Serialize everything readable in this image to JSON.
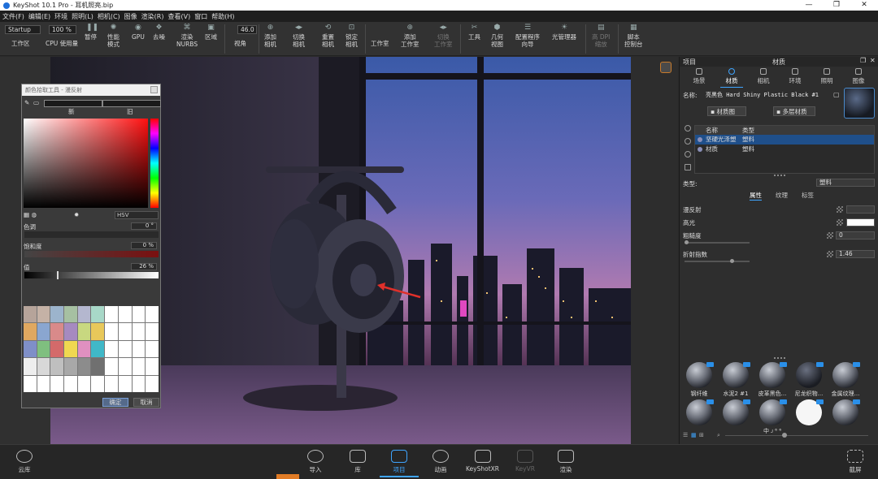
{
  "window": {
    "title": "KeyShot 10.1 Pro  -  耳机照亮.bip",
    "controls": [
      "—",
      "❐",
      "✕"
    ]
  },
  "menu": [
    "文件(F)",
    "编辑(E)",
    "环境",
    "照明(L)",
    "相机(C)",
    "图像",
    "渲染(R)",
    "查看(V)",
    "窗口",
    "帮助(H)"
  ],
  "toolbar": {
    "workspace_select": "Startup",
    "zoom_value": "100 %",
    "fov_value": "46.0",
    "items": [
      {
        "label": "工作区",
        "icon": "workspace-icon"
      },
      {
        "label": "CPU 使用量",
        "icon": "cpu-icon"
      },
      {
        "label": "暂停",
        "icon": "pause-icon"
      },
      {
        "label": "性能\n模式",
        "icon": "performance-icon"
      },
      {
        "label": "GPU",
        "icon": "gpu-icon"
      },
      {
        "label": "去噪",
        "icon": "denoise-icon"
      },
      {
        "label": "渲染\nNURBS",
        "icon": "nurbs-icon"
      },
      {
        "label": "区域",
        "icon": "region-icon"
      },
      {
        "label": "视角",
        "icon": "view-icon"
      },
      {
        "label": "添加\n相机",
        "icon": "add-camera-icon"
      },
      {
        "label": "切换\n相机",
        "icon": "switch-camera-icon"
      },
      {
        "label": "重置\n相机",
        "icon": "reset-camera-icon"
      },
      {
        "label": "锁定\n相机",
        "icon": "lock-camera-icon"
      },
      {
        "label": "工作室",
        "icon": "studio-icon"
      },
      {
        "label": "添加\n工作室",
        "icon": "add-studio-icon"
      },
      {
        "label": "切换\n工作室",
        "icon": "switch-studio-icon"
      },
      {
        "label": "工具",
        "icon": "tools-icon"
      },
      {
        "label": "几何\n视图",
        "icon": "geometry-view-icon"
      },
      {
        "label": "配置程序\n向导",
        "icon": "configurator-icon"
      },
      {
        "label": "光管理器",
        "icon": "light-manager-icon"
      },
      {
        "label": "高 DPI\n缩放",
        "icon": "dpi-icon"
      },
      {
        "label": "脚本\n控制台",
        "icon": "script-console-icon"
      }
    ]
  },
  "color_picker": {
    "title": "颜色拾取工具 - 漫反射",
    "new_label": "新",
    "old_label": "旧",
    "mode": "HSV",
    "hue_label": "色调",
    "hue_value": "0 °",
    "saturation_label": "饱和度",
    "saturation_value": "0 %",
    "value_label": "值",
    "value_value": "26 %",
    "ok": "确定",
    "cancel": "取消",
    "swatches": [
      "#b6a49a",
      "#c5b2a6",
      "#9cb4cc",
      "#a6c0a2",
      "#b4b7cf",
      "#a8d8c8",
      "#ffffff",
      "#ffffff",
      "#ffffff",
      "#ffffff",
      "#e0a860",
      "#8aa6d0",
      "#d98a8a",
      "#a68ac0",
      "#c8d880",
      "#e8c85a",
      "#ffffff",
      "#ffffff",
      "#ffffff",
      "#ffffff",
      "#7f8fc8",
      "#7fbf7f",
      "#d46a6a",
      "#f0d850",
      "#e090c0",
      "#40b8c8",
      "#ffffff",
      "#ffffff",
      "#ffffff",
      "#ffffff",
      "#eeeeee",
      "#d8d8d8",
      "#bfbfbf",
      "#a8a8a8",
      "#8c8c8c",
      "#707070",
      "#ffffff",
      "#ffffff",
      "#ffffff",
      "#ffffff",
      "#ffffff",
      "#ffffff",
      "#ffffff",
      "#ffffff",
      "#ffffff",
      "#ffffff",
      "#ffffff",
      "#ffffff",
      "#ffffff",
      "#ffffff"
    ],
    "hue": 0,
    "saturation": 0,
    "value": 0.26
  },
  "right_panel": {
    "left_title": "项目",
    "center_title": "材质",
    "tabs": [
      "场景",
      "材质",
      "相机",
      "环境",
      "照明",
      "图像"
    ],
    "active_tab": 1,
    "name_label": "名称:",
    "name_value": "亮黑色 Hard Shiny Plastic Black #1",
    "material_graph_btn": "材质图",
    "multi_material_btn": "多层材质",
    "table_headers": [
      "名称",
      "类型"
    ],
    "table_rows": [
      {
        "name": "坚硬光泽塑",
        "type": "塑料",
        "selected": true
      },
      {
        "name": "材质",
        "type": "塑料",
        "selected": false
      }
    ],
    "type_label": "类型:",
    "type_value": "塑料",
    "subtabs": [
      "属性",
      "纹理",
      "标签"
    ],
    "active_subtab": 0,
    "props": [
      {
        "label": "漫反射",
        "value": ""
      },
      {
        "label": "高光",
        "value": ""
      },
      {
        "label": "粗糙度",
        "value": "0"
      },
      {
        "label": "折射指数",
        "value": "1.46"
      }
    ],
    "diffuse_color": "#3c3c3c",
    "specular_color": "#ffffff",
    "library": [
      {
        "label": "钢纤维"
      },
      {
        "label": "水泥2 #1"
      },
      {
        "label": "皮革黑色..."
      },
      {
        "label": "尼龙织物..."
      },
      {
        "label": "金属纹理..."
      },
      {
        "label": ""
      },
      {
        "label": ""
      },
      {
        "label": "中 ᴊ ⁶ ⁶"
      },
      {
        "label": ""
      },
      {
        "label": ""
      }
    ]
  },
  "bottom_bar": {
    "cloud": "云库",
    "import": "导入",
    "library": "库",
    "project": "项目",
    "animation": "动画",
    "keyshotxr": "KeyShotXR",
    "keyvr": "KeyVR",
    "render": "渲染",
    "screenshot": "截屏"
  },
  "colors": {
    "accent": "#3fa5ff",
    "selected_row": "#1f4f8a",
    "panel_bg": "#2e2e2e"
  }
}
